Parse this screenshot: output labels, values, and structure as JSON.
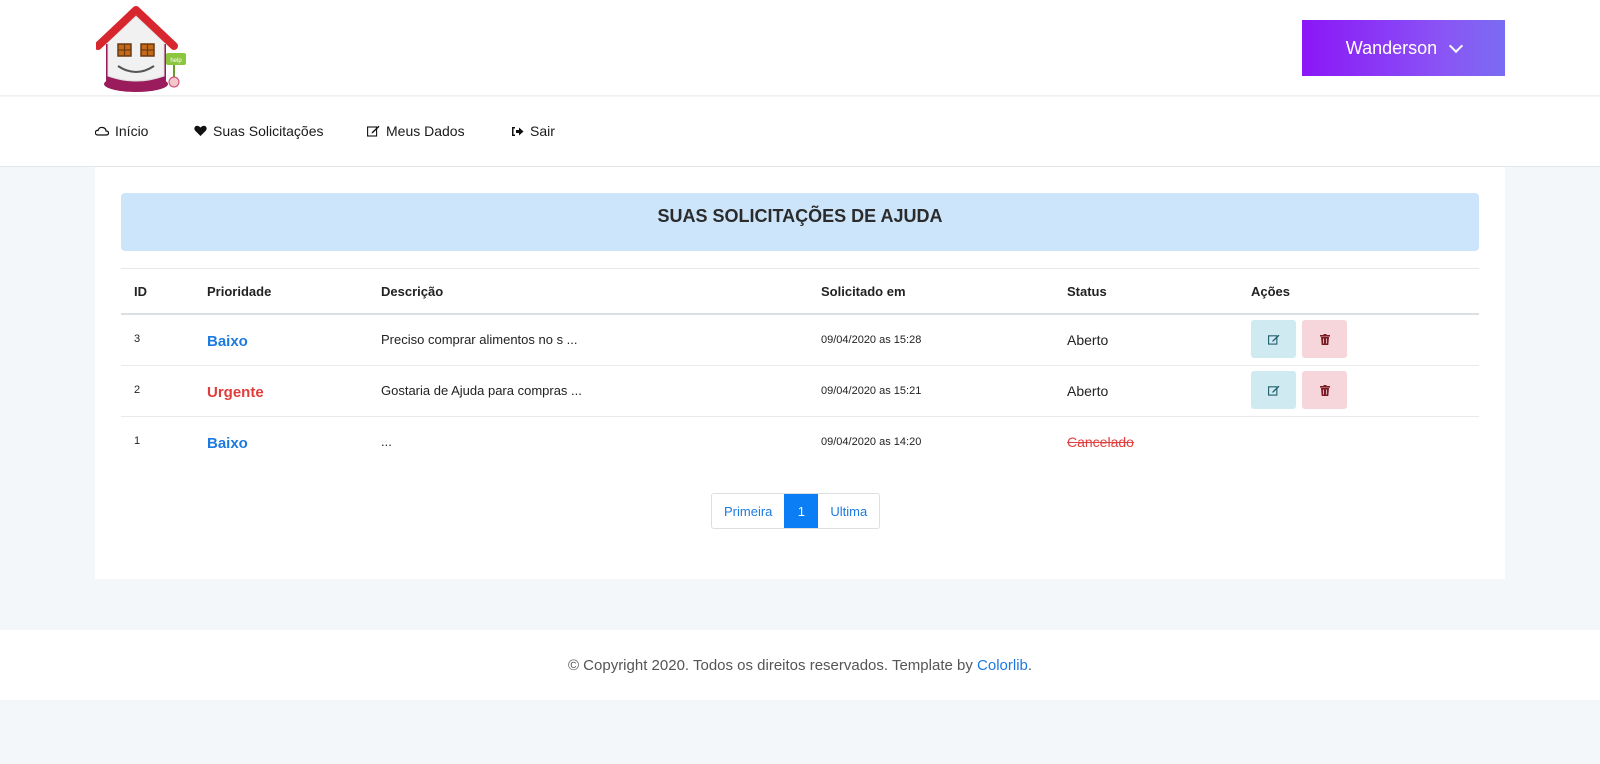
{
  "header": {
    "user_name": "Wanderson",
    "brand_colors": {
      "gradient_start": "#8b16f7",
      "gradient_end": "#7a6cf2"
    }
  },
  "nav": {
    "items": [
      {
        "label": "Início",
        "icon": "cloud-icon"
      },
      {
        "label": "Suas Solicitações",
        "icon": "heart-icon"
      },
      {
        "label": "Meus Dados",
        "icon": "edit-icon"
      },
      {
        "label": "Sair",
        "icon": "sign-out-icon"
      }
    ]
  },
  "main": {
    "title": "SUAS SOLICITAÇÕES DE AJUDA",
    "columns": [
      "ID",
      "Prioridade",
      "Descrição",
      "Solicitado em",
      "Status",
      "Ações"
    ],
    "rows": [
      {
        "id": "3",
        "priority": "Baixo",
        "description": "Preciso comprar alimentos no s ...",
        "requested_at": "09/04/2020 as 15:28",
        "status": "Aberto"
      },
      {
        "id": "2",
        "priority": "Urgente",
        "description": "Gostaria de Ajuda para compras ...",
        "requested_at": "09/04/2020 as 15:21",
        "status": "Aberto"
      },
      {
        "id": "1",
        "priority": "Baixo",
        "description": "...",
        "requested_at": "09/04/2020 as 14:20",
        "status": "Cancelado"
      }
    ],
    "pagination": {
      "first": "Primeira",
      "current": "1",
      "last": "Ultima"
    }
  },
  "footer": {
    "text": "© Copyright 2020. Todos os direitos reservados. Template by ",
    "link": "Colorlib",
    "suffix": "."
  }
}
